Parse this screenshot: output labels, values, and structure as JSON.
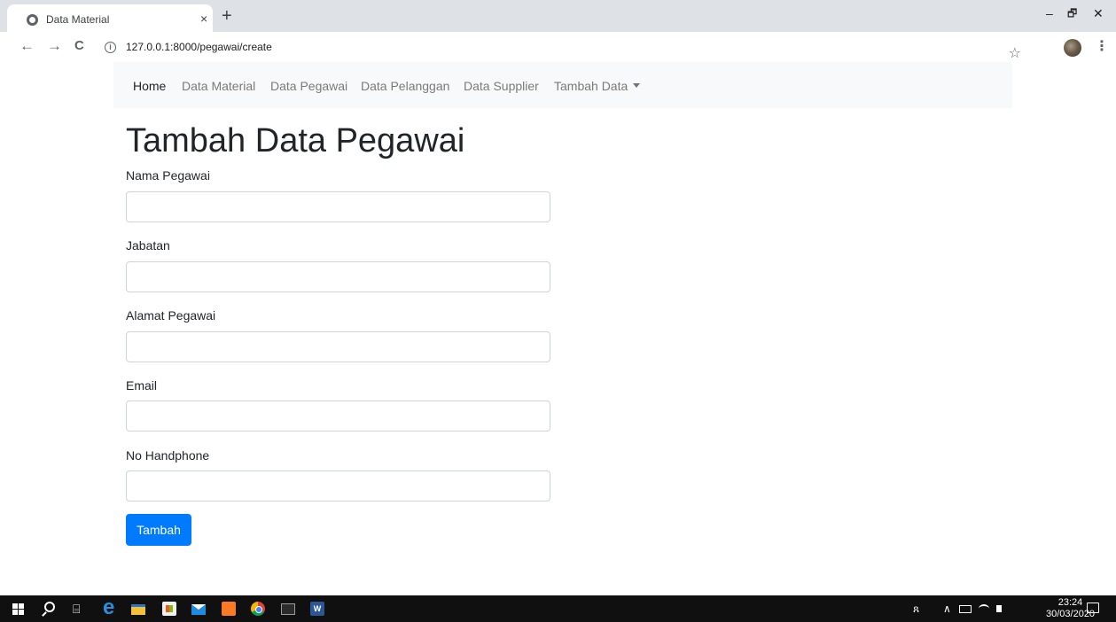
{
  "browser": {
    "tab_title": "Data Material",
    "tab_close": "×",
    "new_tab": "+",
    "url": "127.0.0.1:8000/pegawai/create",
    "back": "←",
    "forward": "→",
    "reload": "C",
    "bookmark_star": "☆",
    "menu": "⋮",
    "window_controls": {
      "minimize": "–",
      "restore": "🗗",
      "close": "✕"
    }
  },
  "navbar": {
    "items": [
      {
        "label": "Home",
        "active": true
      },
      {
        "label": "Data Material",
        "active": false
      },
      {
        "label": "Data Pegawai",
        "active": false
      },
      {
        "label": "Data Pelanggan",
        "active": false
      },
      {
        "label": "Data Supplier",
        "active": false
      },
      {
        "label": "Tambah Data",
        "active": false,
        "dropdown": true
      }
    ]
  },
  "form": {
    "title": "Tambah Data Pegawai",
    "fields": [
      {
        "label": "Nama Pegawai",
        "value": ""
      },
      {
        "label": "Jabatan",
        "value": ""
      },
      {
        "label": "Alamat Pegawai",
        "value": ""
      },
      {
        "label": "Email",
        "value": ""
      },
      {
        "label": "No Handphone",
        "value": ""
      }
    ],
    "submit_label": "Tambah"
  },
  "taskbar": {
    "taskview_glyph": "⌸",
    "edge_glyph": "e",
    "word_glyph": "W",
    "tray_people": "ጸ",
    "tray_up": "∧",
    "time": "23:24",
    "date": "30/03/2020"
  },
  "colors": {
    "primary": "#007bff",
    "navbar_bg": "#f8f9fa",
    "tabstrip_bg": "#dee1e6",
    "taskbar_bg": "#101010"
  },
  "icons": [
    "globe-icon",
    "info-icon",
    "star-icon",
    "profile-avatar",
    "windows-start-icon",
    "search-icon",
    "task-view-icon",
    "edge-icon",
    "file-explorer-icon",
    "store-icon",
    "mail-icon",
    "xampp-icon",
    "chrome-icon",
    "cmd-icon",
    "word-icon",
    "notification-icon"
  ]
}
